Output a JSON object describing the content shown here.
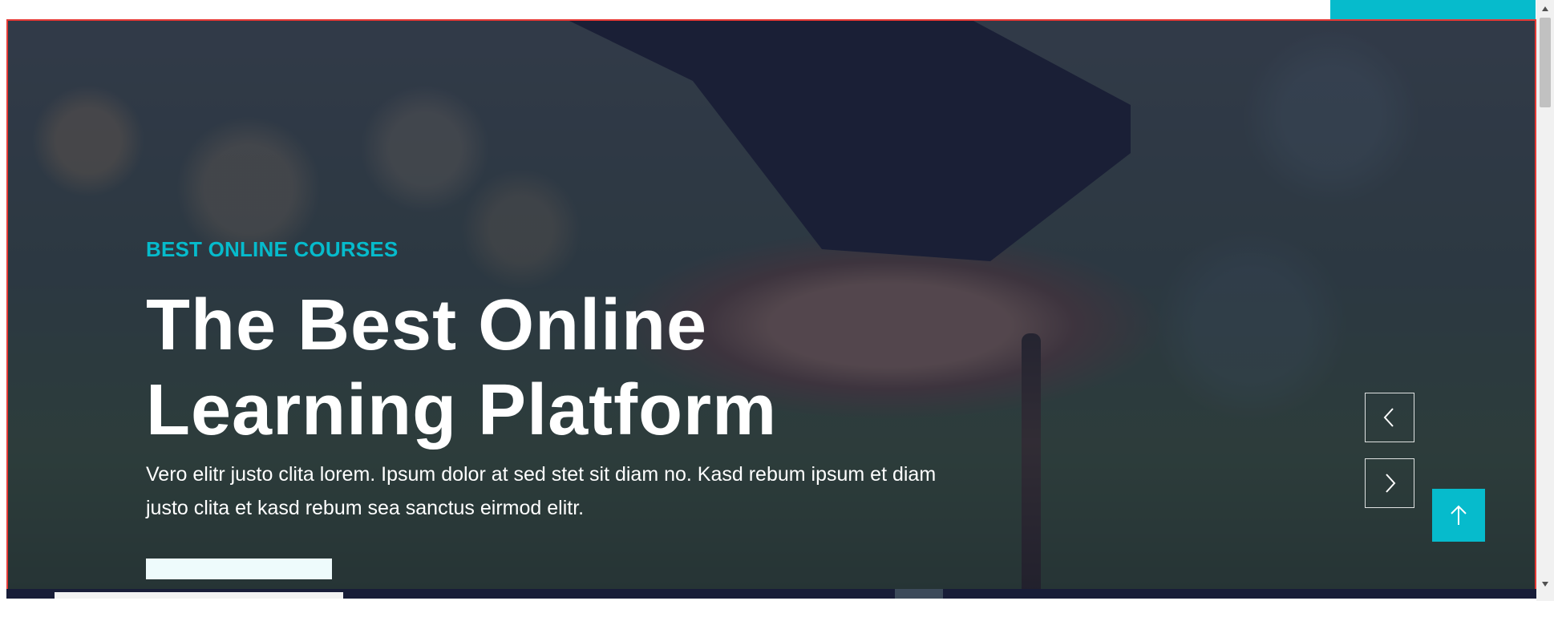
{
  "hero": {
    "eyebrow": "BEST ONLINE COURSES",
    "title_line1": "The Best Online",
    "title_line2": "Learning Platform",
    "description": "Vero elitr justo clita lorem. Ipsum dolor at sed stet sit diam no. Kasd rebum ipsum et diam justo clita et kasd rebum sea sanctus eirmod elitr."
  },
  "carousel": {
    "prev_icon": "chevron-left-icon",
    "next_icon": "chevron-right-icon"
  },
  "back_to_top": {
    "icon": "arrow-up-icon"
  },
  "colors": {
    "accent": "#06bbcc",
    "overlay": "#181d38",
    "text": "#ffffff",
    "frame": "#e53935"
  }
}
